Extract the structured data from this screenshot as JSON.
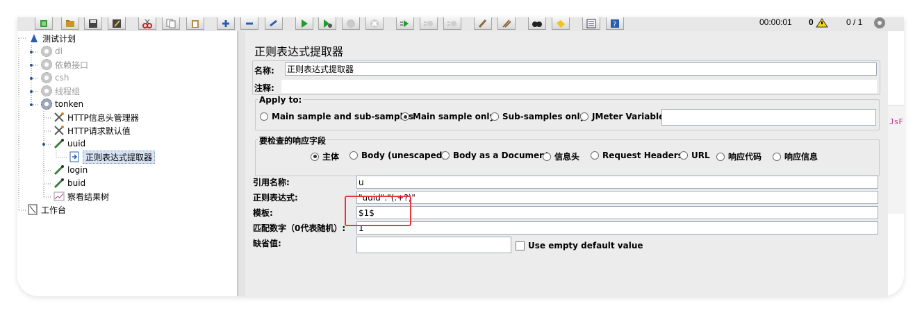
{
  "toolbar": {
    "buttons": [
      "templates-icon",
      "open-icon",
      "save-icon",
      "saveas-icon",
      "cut-icon",
      "copy-icon",
      "paste-icon",
      "expand-icon",
      "collapse-icon",
      "toggle-icon",
      "start-icon",
      "start-no-pause-icon",
      "stop-icon",
      "shutdown-icon",
      "remote-start-icon",
      "remote-stop-icon",
      "remote-shutdown-icon",
      "broom-icon",
      "clear-all-icon",
      "search-icon",
      "reset-search-icon",
      "function-helper-icon",
      "help-icon"
    ],
    "timer": "00:00:01",
    "warnings": "0",
    "threads": "0 / 1"
  },
  "tree": {
    "items": [
      {
        "label": "测试计划",
        "level": 0,
        "icon": "testplan-icon",
        "enabled": true
      },
      {
        "label": "dl",
        "level": 1,
        "icon": "gear-icon",
        "enabled": false
      },
      {
        "label": "依赖接口",
        "level": 1,
        "icon": "gear-icon",
        "enabled": false
      },
      {
        "label": "csh",
        "level": 1,
        "icon": "gear-icon",
        "enabled": false
      },
      {
        "label": "线程组",
        "level": 1,
        "icon": "gear-icon",
        "enabled": false
      },
      {
        "label": "tonken",
        "level": 1,
        "icon": "gear-icon",
        "enabled": true
      },
      {
        "label": "HTTP信息头管理器",
        "level": 2,
        "icon": "wrench-icon",
        "enabled": true
      },
      {
        "label": "HTTP请求默认值",
        "level": 2,
        "icon": "wrench-icon",
        "enabled": true
      },
      {
        "label": "uuid",
        "level": 2,
        "icon": "pipette-icon",
        "enabled": true
      },
      {
        "label": "正则表达式提取器",
        "level": 3,
        "icon": "extractor-icon",
        "enabled": true,
        "selected": true
      },
      {
        "label": "login",
        "level": 2,
        "icon": "pipette-icon",
        "enabled": true
      },
      {
        "label": "buid",
        "level": 2,
        "icon": "pipette-icon",
        "enabled": true
      },
      {
        "label": "察看结果树",
        "level": 2,
        "icon": "chart-icon",
        "enabled": true
      },
      {
        "label": "工作台",
        "level": 0,
        "icon": "workbench-icon",
        "enabled": true
      }
    ]
  },
  "panel": {
    "title": "正则表达式提取器",
    "name_label": "名称:",
    "name_value": "正则表达式提取器",
    "comment_label": "注释:",
    "apply_to": {
      "title": "Apply to:",
      "options": [
        "Main sample and sub-samples",
        "Main sample only",
        "Sub-samples only",
        "JMeter Variable"
      ],
      "selected": 1
    },
    "response_field": {
      "title": "要检查的响应字段",
      "options": [
        "主体",
        "Body (unescaped)",
        "Body as a Document",
        "信息头",
        "Request Headers",
        "URL",
        "响应代码",
        "响应信息"
      ],
      "selected": 0
    },
    "ref_name_label": "引用名称:",
    "ref_name_value": "u",
    "regex_label": "正则表达式:",
    "regex_value": "\"uuid\":\"(.+?)\"",
    "template_label": "模板:",
    "template_value": "$1$",
    "match_no_label": "匹配数字（0代表随机）:",
    "match_no_value": "1",
    "default_label": "缺省值:",
    "default_value": "",
    "use_empty_label": "Use empty default value"
  },
  "right_strip_text": "JsF:",
  "colors": {
    "highlight": "#e8383d",
    "selection": "#d7e3f4"
  }
}
